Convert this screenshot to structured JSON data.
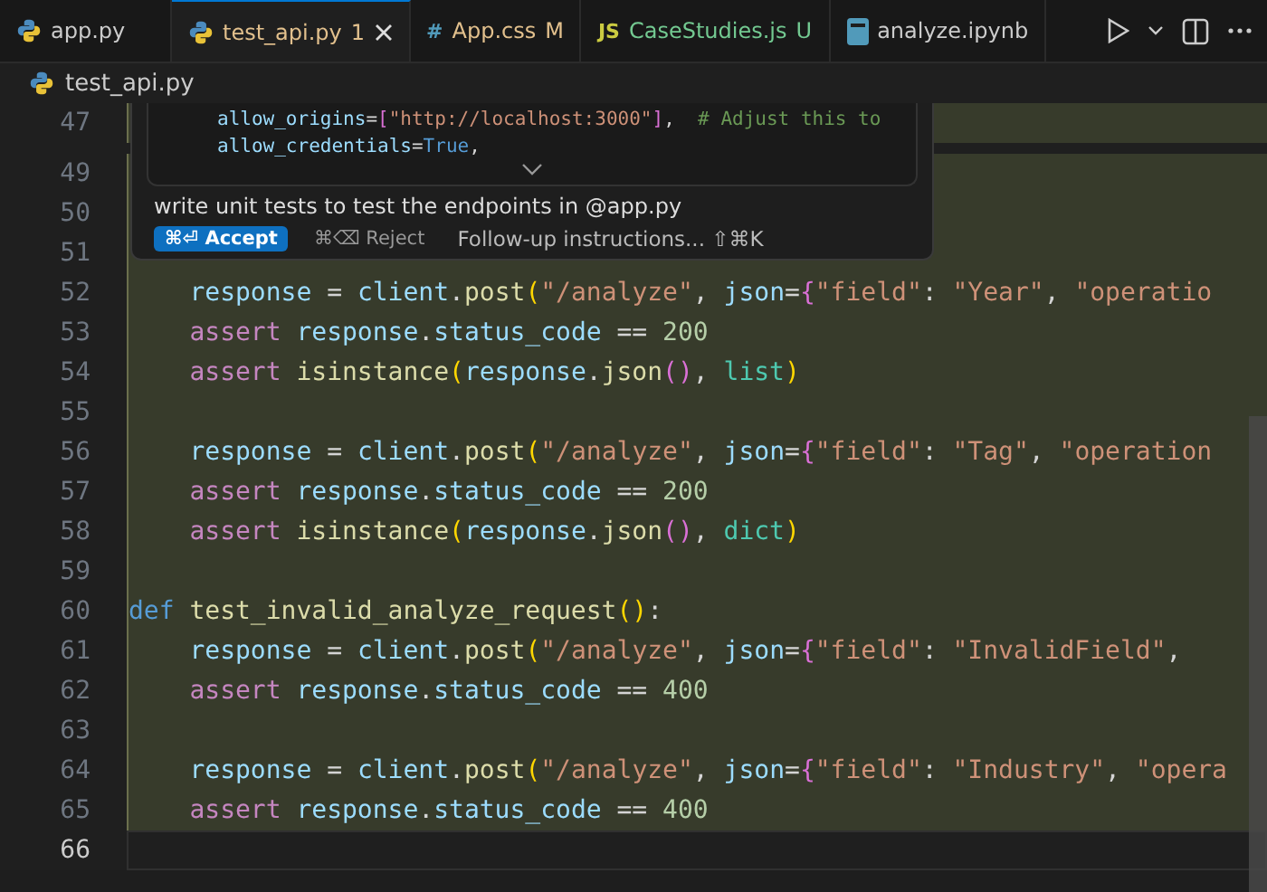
{
  "tabs": [
    {
      "label": "app.py",
      "kind": "python",
      "selected": false,
      "color": "#cccccc"
    },
    {
      "label": "test_api.py",
      "kind": "python",
      "badge": "1",
      "selected": true,
      "color": "#e2c08d",
      "closable": true
    },
    {
      "label": "App.css",
      "kind": "css",
      "icon_text": "#",
      "badge": "M",
      "selected": false,
      "color": "#e2c08d"
    },
    {
      "label": "CaseStudies.js",
      "kind": "js",
      "icon_text": "JS",
      "badge": "U",
      "selected": false,
      "color": "#73c991"
    },
    {
      "label": "analyze.ipynb",
      "kind": "notebook",
      "selected": false,
      "color": "#cccccc"
    }
  ],
  "breadcrumb": {
    "file": "test_api.py"
  },
  "inline_edit": {
    "code": [
      [
        {
          "text": "allow_origins",
          "kind": "var"
        },
        {
          "text": "=",
          "kind": "op"
        },
        {
          "text": "[",
          "kind": "brace"
        },
        {
          "text": "\"http://localhost:3000\"",
          "kind": "str"
        },
        {
          "text": "]",
          "kind": "brace"
        },
        {
          "text": ",  ",
          "kind": "op"
        },
        {
          "text": "# Adjust this to",
          "kind": "comment"
        }
      ],
      [
        {
          "text": "allow_credentials",
          "kind": "var"
        },
        {
          "text": "=",
          "kind": "op"
        },
        {
          "text": "True",
          "kind": "def"
        },
        {
          "text": ",",
          "kind": "op"
        }
      ]
    ],
    "prompt": "write unit tests to test the endpoints in @app.py",
    "accept": {
      "shortcut": "⌘⏎",
      "label": "Accept"
    },
    "reject": {
      "shortcut": "⌘⌫",
      "label": "Reject"
    },
    "followup": {
      "placeholder": "Follow-up instructions...",
      "shortcut": "⇧⌘K"
    }
  },
  "lines": [
    {
      "number": "47",
      "added": true
    },
    {
      "number": "49",
      "added": true
    },
    {
      "number": "50",
      "added": true
    },
    {
      "number": "51",
      "added": true
    },
    {
      "number": "52",
      "added": true,
      "tokens": [
        {
          "text": "    response",
          "kind": "var"
        },
        {
          "text": " = ",
          "kind": "op"
        },
        {
          "text": "client",
          "kind": "var"
        },
        {
          "text": ".",
          "kind": "op"
        },
        {
          "text": "post",
          "kind": "fn"
        },
        {
          "text": "(",
          "kind": "paren"
        },
        {
          "text": "\"/analyze\"",
          "kind": "str"
        },
        {
          "text": ", ",
          "kind": "op"
        },
        {
          "text": "json",
          "kind": "var"
        },
        {
          "text": "=",
          "kind": "op"
        },
        {
          "text": "{",
          "kind": "brace"
        },
        {
          "text": "\"field\"",
          "kind": "str"
        },
        {
          "text": ": ",
          "kind": "op"
        },
        {
          "text": "\"Year\"",
          "kind": "str"
        },
        {
          "text": ", ",
          "kind": "op"
        },
        {
          "text": "\"operatio",
          "kind": "str"
        }
      ]
    },
    {
      "number": "53",
      "added": true,
      "tokens": [
        {
          "text": "    assert ",
          "kind": "kw"
        },
        {
          "text": "response",
          "kind": "var"
        },
        {
          "text": ".",
          "kind": "op"
        },
        {
          "text": "status_code",
          "kind": "var"
        },
        {
          "text": " == ",
          "kind": "op"
        },
        {
          "text": "200",
          "kind": "num"
        }
      ]
    },
    {
      "number": "54",
      "added": true,
      "tokens": [
        {
          "text": "    assert ",
          "kind": "kw"
        },
        {
          "text": "isinstance",
          "kind": "fn"
        },
        {
          "text": "(",
          "kind": "paren"
        },
        {
          "text": "response",
          "kind": "var"
        },
        {
          "text": ".",
          "kind": "op"
        },
        {
          "text": "json",
          "kind": "fn"
        },
        {
          "text": "()",
          "kind": "brace"
        },
        {
          "text": ", ",
          "kind": "op"
        },
        {
          "text": "list",
          "kind": "type"
        },
        {
          "text": ")",
          "kind": "paren"
        }
      ]
    },
    {
      "number": "55",
      "added": true
    },
    {
      "number": "56",
      "added": true,
      "tokens": [
        {
          "text": "    response",
          "kind": "var"
        },
        {
          "text": " = ",
          "kind": "op"
        },
        {
          "text": "client",
          "kind": "var"
        },
        {
          "text": ".",
          "kind": "op"
        },
        {
          "text": "post",
          "kind": "fn"
        },
        {
          "text": "(",
          "kind": "paren"
        },
        {
          "text": "\"/analyze\"",
          "kind": "str"
        },
        {
          "text": ", ",
          "kind": "op"
        },
        {
          "text": "json",
          "kind": "var"
        },
        {
          "text": "=",
          "kind": "op"
        },
        {
          "text": "{",
          "kind": "brace"
        },
        {
          "text": "\"field\"",
          "kind": "str"
        },
        {
          "text": ": ",
          "kind": "op"
        },
        {
          "text": "\"Tag\"",
          "kind": "str"
        },
        {
          "text": ", ",
          "kind": "op"
        },
        {
          "text": "\"operation",
          "kind": "str"
        }
      ]
    },
    {
      "number": "57",
      "added": true,
      "tokens": [
        {
          "text": "    assert ",
          "kind": "kw"
        },
        {
          "text": "response",
          "kind": "var"
        },
        {
          "text": ".",
          "kind": "op"
        },
        {
          "text": "status_code",
          "kind": "var"
        },
        {
          "text": " == ",
          "kind": "op"
        },
        {
          "text": "200",
          "kind": "num"
        }
      ]
    },
    {
      "number": "58",
      "added": true,
      "tokens": [
        {
          "text": "    assert ",
          "kind": "kw"
        },
        {
          "text": "isinstance",
          "kind": "fn"
        },
        {
          "text": "(",
          "kind": "paren"
        },
        {
          "text": "response",
          "kind": "var"
        },
        {
          "text": ".",
          "kind": "op"
        },
        {
          "text": "json",
          "kind": "fn"
        },
        {
          "text": "()",
          "kind": "brace"
        },
        {
          "text": ", ",
          "kind": "op"
        },
        {
          "text": "dict",
          "kind": "type"
        },
        {
          "text": ")",
          "kind": "paren"
        }
      ]
    },
    {
      "number": "59",
      "added": true
    },
    {
      "number": "60",
      "added": true,
      "tokens": [
        {
          "text": "def ",
          "kind": "def"
        },
        {
          "text": "test_invalid_analyze_request",
          "kind": "fn"
        },
        {
          "text": "()",
          "kind": "paren"
        },
        {
          "text": ":",
          "kind": "op"
        }
      ]
    },
    {
      "number": "61",
      "added": true,
      "tokens": [
        {
          "text": "    response",
          "kind": "var"
        },
        {
          "text": " = ",
          "kind": "op"
        },
        {
          "text": "client",
          "kind": "var"
        },
        {
          "text": ".",
          "kind": "op"
        },
        {
          "text": "post",
          "kind": "fn"
        },
        {
          "text": "(",
          "kind": "paren"
        },
        {
          "text": "\"/analyze\"",
          "kind": "str"
        },
        {
          "text": ", ",
          "kind": "op"
        },
        {
          "text": "json",
          "kind": "var"
        },
        {
          "text": "=",
          "kind": "op"
        },
        {
          "text": "{",
          "kind": "brace"
        },
        {
          "text": "\"field\"",
          "kind": "str"
        },
        {
          "text": ": ",
          "kind": "op"
        },
        {
          "text": "\"InvalidField\"",
          "kind": "str"
        },
        {
          "text": ",",
          "kind": "op"
        }
      ]
    },
    {
      "number": "62",
      "added": true,
      "tokens": [
        {
          "text": "    assert ",
          "kind": "kw"
        },
        {
          "text": "response",
          "kind": "var"
        },
        {
          "text": ".",
          "kind": "op"
        },
        {
          "text": "status_code",
          "kind": "var"
        },
        {
          "text": " == ",
          "kind": "op"
        },
        {
          "text": "400",
          "kind": "num"
        }
      ]
    },
    {
      "number": "63",
      "added": true
    },
    {
      "number": "64",
      "added": true,
      "tokens": [
        {
          "text": "    response",
          "kind": "var"
        },
        {
          "text": " = ",
          "kind": "op"
        },
        {
          "text": "client",
          "kind": "var"
        },
        {
          "text": ".",
          "kind": "op"
        },
        {
          "text": "post",
          "kind": "fn"
        },
        {
          "text": "(",
          "kind": "paren"
        },
        {
          "text": "\"/analyze\"",
          "kind": "str"
        },
        {
          "text": ", ",
          "kind": "op"
        },
        {
          "text": "json",
          "kind": "var"
        },
        {
          "text": "=",
          "kind": "op"
        },
        {
          "text": "{",
          "kind": "brace"
        },
        {
          "text": "\"field\"",
          "kind": "str"
        },
        {
          "text": ": ",
          "kind": "op"
        },
        {
          "text": "\"Industry\"",
          "kind": "str"
        },
        {
          "text": ", ",
          "kind": "op"
        },
        {
          "text": "\"opera",
          "kind": "str"
        }
      ]
    },
    {
      "number": "65",
      "added": true,
      "tokens": [
        {
          "text": "    assert ",
          "kind": "kw"
        },
        {
          "text": "response",
          "kind": "var"
        },
        {
          "text": ".",
          "kind": "op"
        },
        {
          "text": "status_code",
          "kind": "var"
        },
        {
          "text": " == ",
          "kind": "op"
        },
        {
          "text": "400",
          "kind": "num"
        }
      ]
    },
    {
      "number": "66",
      "added": false
    }
  ]
}
